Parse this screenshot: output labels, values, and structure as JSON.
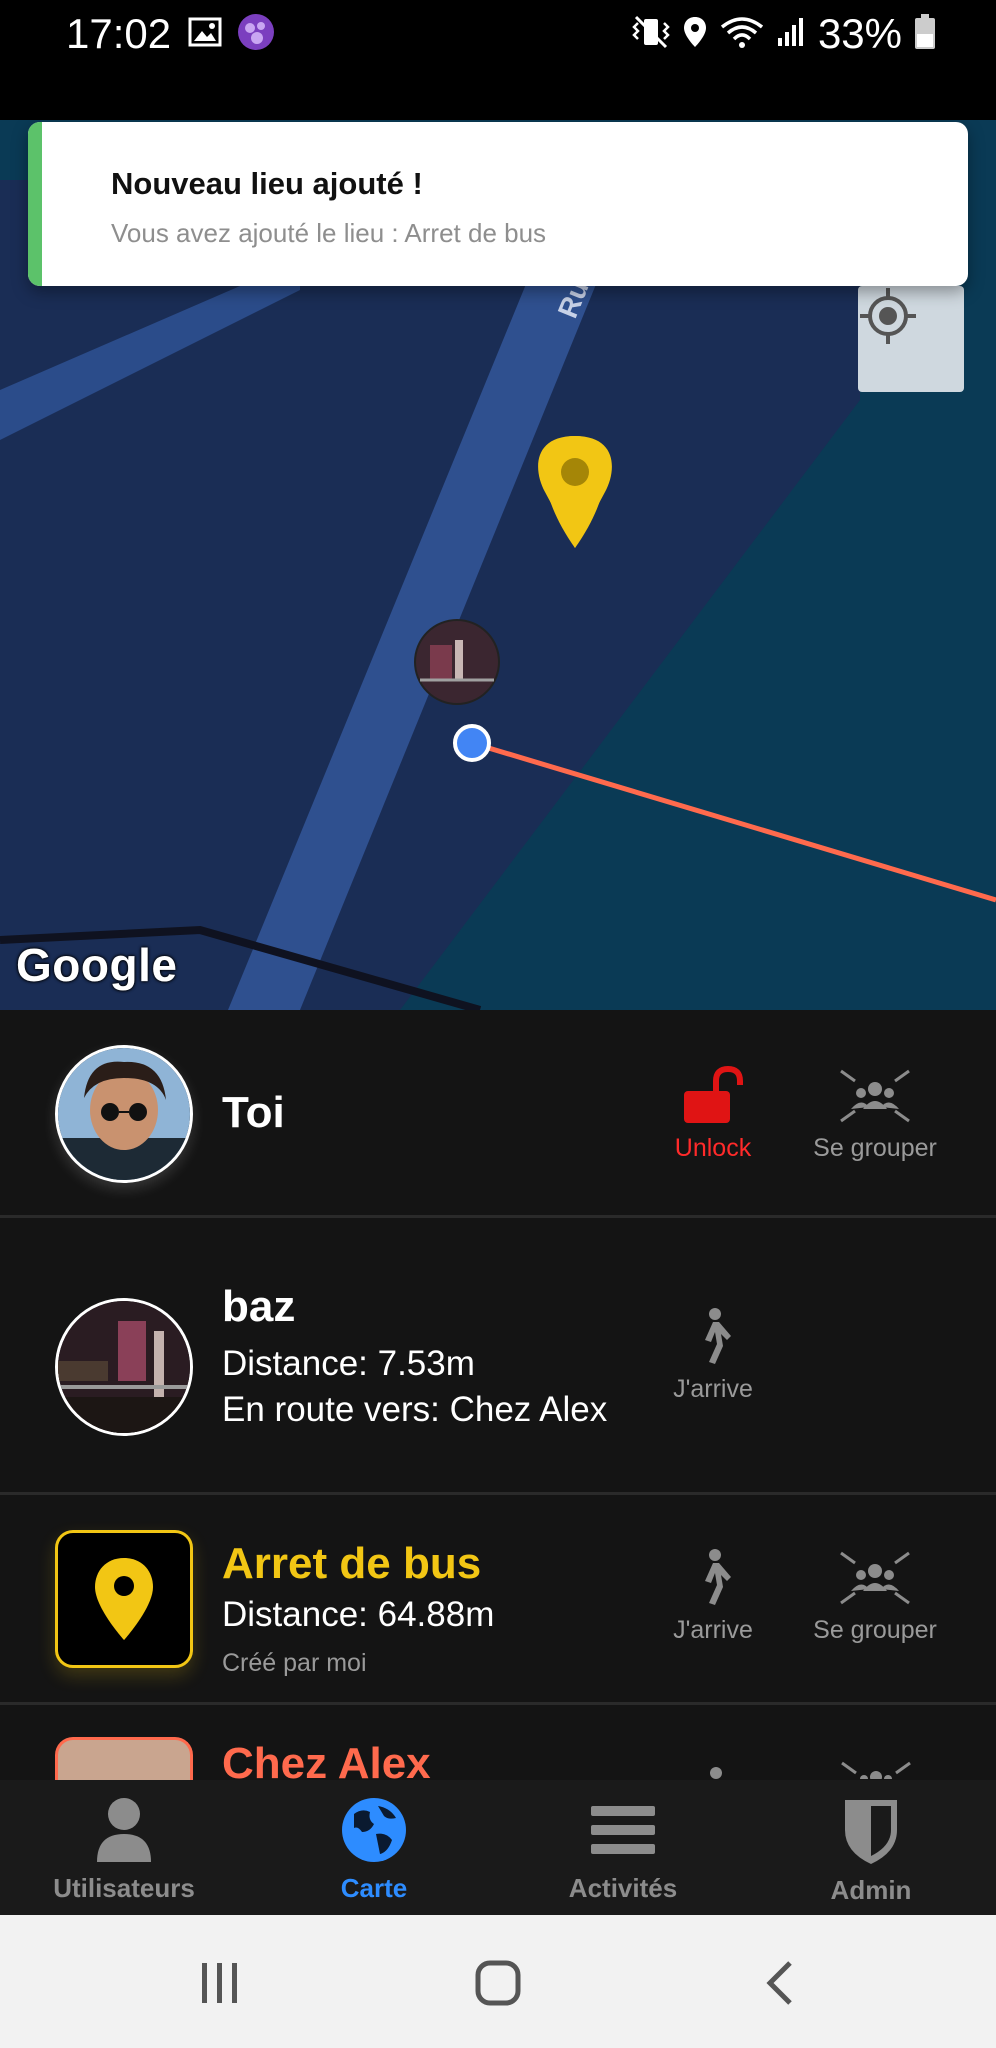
{
  "status_bar": {
    "time": "17:02",
    "battery_percent": "33%",
    "icons": [
      "gallery-icon",
      "app-notification-icon",
      "vibrate-icon",
      "location-icon",
      "wifi-icon",
      "signal-icon",
      "battery-icon"
    ]
  },
  "toast": {
    "title": "Nouveau lieu ajouté !",
    "message": "Vous avez ajouté le lieu : Arret de bus",
    "accent_color": "#5cc26a"
  },
  "map": {
    "street_label": "Ru",
    "attribution": "Google",
    "locate_icon": "my-location-icon",
    "marker_color": "#f2c614",
    "route_color": "#ff6a4d",
    "user_dot_color": "#4285f4"
  },
  "list": {
    "self": {
      "name": "Toi",
      "unlock_label": "Unlock",
      "group_label": "Se grouper"
    },
    "users": [
      {
        "name": "baz",
        "distance": "Distance: 7.53m",
        "destination": "En route vers: Chez Alex",
        "arrive_label": "J'arrive"
      }
    ],
    "places": [
      {
        "name": "Arret de bus",
        "distance": "Distance: 64.88m",
        "created_by": "Créé par moi",
        "arrive_label": "J'arrive",
        "group_label": "Se grouper",
        "color": "#f2c614"
      },
      {
        "name": "Chez Alex",
        "color": "#ff6a4d"
      }
    ]
  },
  "bottom_nav": {
    "items": [
      {
        "label": "Utilisateurs",
        "icon": "person-icon"
      },
      {
        "label": "Carte",
        "icon": "globe-icon",
        "active": true
      },
      {
        "label": "Activités",
        "icon": "menu-icon"
      },
      {
        "label": "Admin",
        "icon": "shield-icon"
      }
    ],
    "active_color": "#2d8cff"
  }
}
